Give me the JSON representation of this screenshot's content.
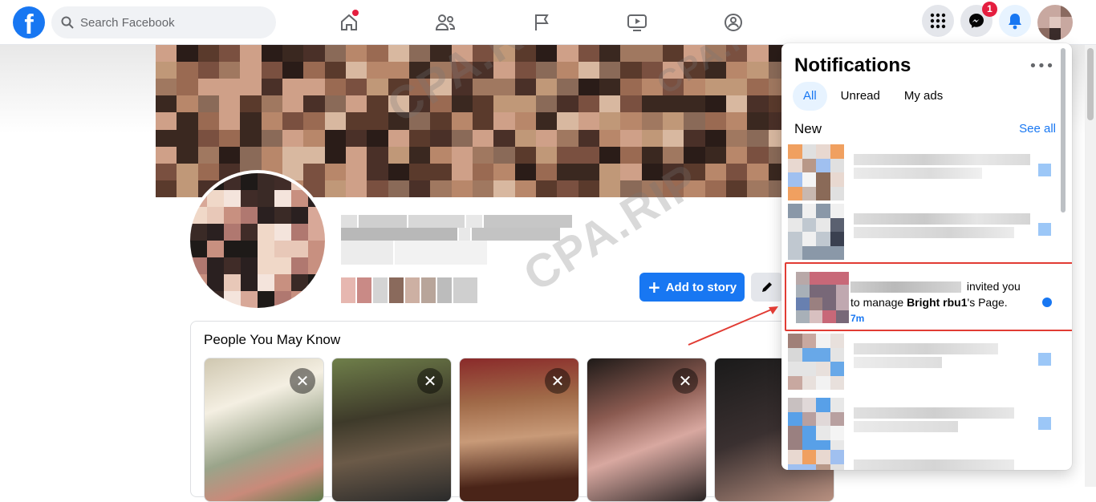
{
  "topbar": {
    "logo_text": "f",
    "search_placeholder": "Search Facebook",
    "nav": [
      "home-icon",
      "friends-icon",
      "pages-flag-icon",
      "watch-icon",
      "groups-icon"
    ],
    "messenger_badge": "1",
    "accent": "#1877f2"
  },
  "profile": {
    "add_story_label": "Add to story"
  },
  "people_you_may_know": {
    "title": "People You May Know",
    "close_glyph": "✕"
  },
  "notifications": {
    "title": "Notifications",
    "more_glyph": "•••",
    "tabs": [
      "All",
      "Unread",
      "My ads"
    ],
    "active_tab": "All",
    "section_label": "New",
    "see_all_label": "See all",
    "highlighted": {
      "text_after_name": "invited you",
      "line2_prefix": "to manage ",
      "page_name": "Bright rbu1",
      "line2_suffix": "'s Page.",
      "time": "7m"
    }
  },
  "watermark": "CPA.RIP"
}
